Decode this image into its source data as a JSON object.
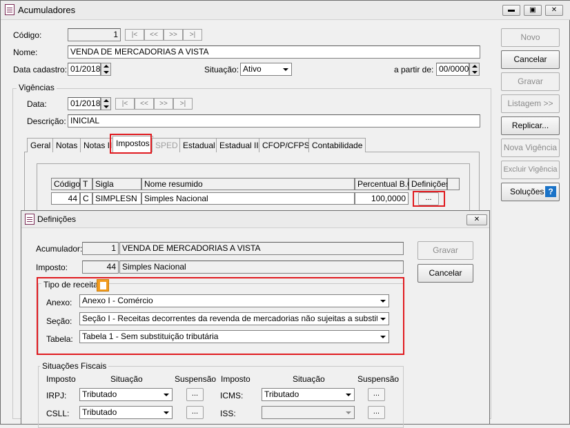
{
  "main_window": {
    "title": "Acumuladores",
    "fields": {
      "codigo_label": "Código:",
      "codigo_value": "1",
      "nome_label": "Nome:",
      "nome_value": "VENDA DE MERCADORIAS A VISTA",
      "data_cadastro_label": "Data cadastro:",
      "data_cadastro_value": "01/2018",
      "situacao_label": "Situação:",
      "situacao_value": "Ativo",
      "a_partir_label": "a partir de:",
      "a_partir_value": "00/0000"
    },
    "nav_buttons": [
      "|<",
      "<<",
      ">>",
      ">|"
    ],
    "vigencias": {
      "title": "Vigências",
      "data_label": "Data:",
      "data_value": "01/2018",
      "descricao_label": "Descrição:",
      "descricao_value": "INICIAL"
    },
    "tabs": [
      "Geral",
      "Notas",
      "Notas II",
      "Impostos",
      "SPED",
      "Estadual",
      "Estadual II",
      "CFOP/CFPS",
      "Contabilidade"
    ],
    "grid": {
      "columns": [
        "Código",
        "T",
        "Sigla",
        "Nome resumido",
        "Percentual B.C.",
        "Definições"
      ],
      "row": {
        "codigo": "44",
        "t": "C",
        "sigla": "SIMPLESN",
        "nome": "Simples Nacional",
        "percentual": "100,0000",
        "definicoes": "..."
      }
    },
    "side_buttons": {
      "novo": "Novo",
      "cancelar": "Cancelar",
      "gravar": "Gravar",
      "listagem": "Listagem >>",
      "replicar": "Replicar...",
      "nova_vigencia": "Nova Vigência",
      "excluir_vigencia": "Excluir Vigência",
      "solucoes": "Soluções"
    }
  },
  "dialog": {
    "title": "Definições",
    "acumulador_label": "Acumulador:",
    "acumulador_code": "1",
    "acumulador_name": "VENDA DE MERCADORIAS A VISTA",
    "imposto_label": "Imposto:",
    "imposto_code": "44",
    "imposto_name": "Simples Nacional",
    "gravar": "Gravar",
    "cancelar": "Cancelar",
    "tipo_receita": {
      "title": "Tipo de receita",
      "anexo_label": "Anexo:",
      "anexo_value": "Anexo I - Comércio",
      "secao_label": "Seção:",
      "secao_value": "Seção I - Receitas decorrentes da revenda de mercadorias não sujeitas a substituição tribu",
      "tabela_label": "Tabela:",
      "tabela_value": "Tabela 1 - Sem substituição tributária"
    },
    "situacoes_fiscais": {
      "title": "Situações Fiscais",
      "headers": {
        "imposto": "Imposto",
        "situacao": "Situação",
        "suspensao": "Suspensão"
      },
      "left": [
        {
          "imposto": "IRPJ:",
          "situacao": "Tributado"
        },
        {
          "imposto": "CSLL:",
          "situacao": "Tributado"
        }
      ],
      "right": [
        {
          "imposto": "ICMS:",
          "situacao": "Tributado"
        },
        {
          "imposto": "ISS:",
          "situacao": ""
        }
      ],
      "suspensao_btn": "..."
    }
  },
  "colors": {
    "highlight": "#e0191e",
    "help_icon_bg": "#1a73c8",
    "receita_icon_bg": "#f29b1d"
  }
}
